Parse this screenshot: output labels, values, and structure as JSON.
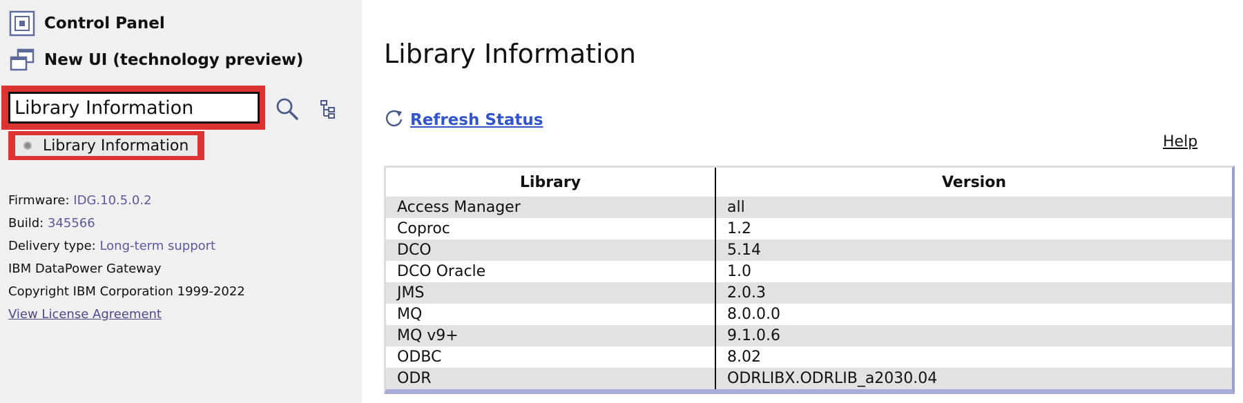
{
  "sidebar": {
    "control_panel_label": "Control Panel",
    "new_ui_label": "New UI (technology preview)",
    "search": {
      "value": "Library Information",
      "placeholder": ""
    },
    "search_result": "Library Information",
    "info": {
      "firmware_label": "Firmware:",
      "firmware_value": "IDG.10.5.0.2",
      "build_label": "Build:",
      "build_value": "345566",
      "delivery_label": "Delivery type:",
      "delivery_value": "Long-term support",
      "product": "IBM DataPower Gateway",
      "copyright": "Copyright IBM Corporation 1999-2022",
      "license_link": "View License Agreement"
    }
  },
  "main": {
    "title": "Library Information",
    "refresh_label": "Refresh Status",
    "help_label": "Help",
    "table": {
      "headers": [
        "Library",
        "Version"
      ],
      "rows": [
        [
          "Access Manager",
          "all"
        ],
        [
          "Coproc",
          "1.2"
        ],
        [
          "DCO",
          "5.14"
        ],
        [
          "DCO Oracle",
          "1.0"
        ],
        [
          "JMS",
          "2.0.3"
        ],
        [
          "MQ",
          "8.0.0.0"
        ],
        [
          "MQ v9+",
          "9.1.0.6"
        ],
        [
          "ODBC",
          "8.02"
        ],
        [
          "ODR",
          "ODRLIBX.ODRLIB_a2030.04"
        ]
      ]
    }
  },
  "colors": {
    "sidebar_bg": "#f0f0f0",
    "highlight_red": "#dd3333",
    "link_blue": "#3355cc",
    "info_value": "#5a5a9a",
    "row_shade": "#e2e2e2",
    "table_border_accent": "#a6aed8"
  },
  "icons": {
    "control_panel": "control-panel-icon",
    "new_ui": "new-window-icon",
    "search": "search-icon",
    "tree": "tree-view-icon",
    "refresh": "refresh-icon",
    "result_bullet": "bullet-icon"
  }
}
